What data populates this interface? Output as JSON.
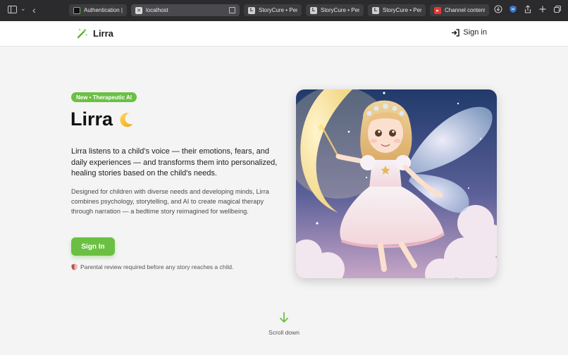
{
  "browser": {
    "tabs": [
      {
        "title": "Authentication |...",
        "favicon_color": "#2e2e2e"
      },
      {
        "title": "localhost",
        "favicon_color": "#d9d9d9"
      },
      {
        "title": "StoryCure • Per...",
        "favicon_color": "#cfcfcf"
      },
      {
        "title": "StoryCure • Per...",
        "favicon_color": "#cfcfcf"
      },
      {
        "title": "StoryCure • Per...",
        "favicon_color": "#cfcfcf"
      },
      {
        "title": "Channel content...",
        "favicon_color": "#e53935"
      }
    ]
  },
  "header": {
    "logo_text": "Lirra",
    "signin_label": "Sign in"
  },
  "hero": {
    "badge": "New • Therapeutic AI",
    "title": "Lirra",
    "lead": "Lirra listens to a child’s voice — their emotions, fears, and daily experiences — and transforms them into personalized, healing stories based on the child's needs.",
    "description": "Designed for children with diverse needs and developing minds, Lirra combines psychology, storytelling, and AI to create magical therapy through narration — a bedtime story reimagined for wellbeing.",
    "cta_label": "Sign In",
    "note": "Parental review required before any story reaches a child."
  },
  "scroll": {
    "label": "Scroll down"
  },
  "colors": {
    "accent": "#6bc043",
    "chrome": "#2b2b2d"
  }
}
